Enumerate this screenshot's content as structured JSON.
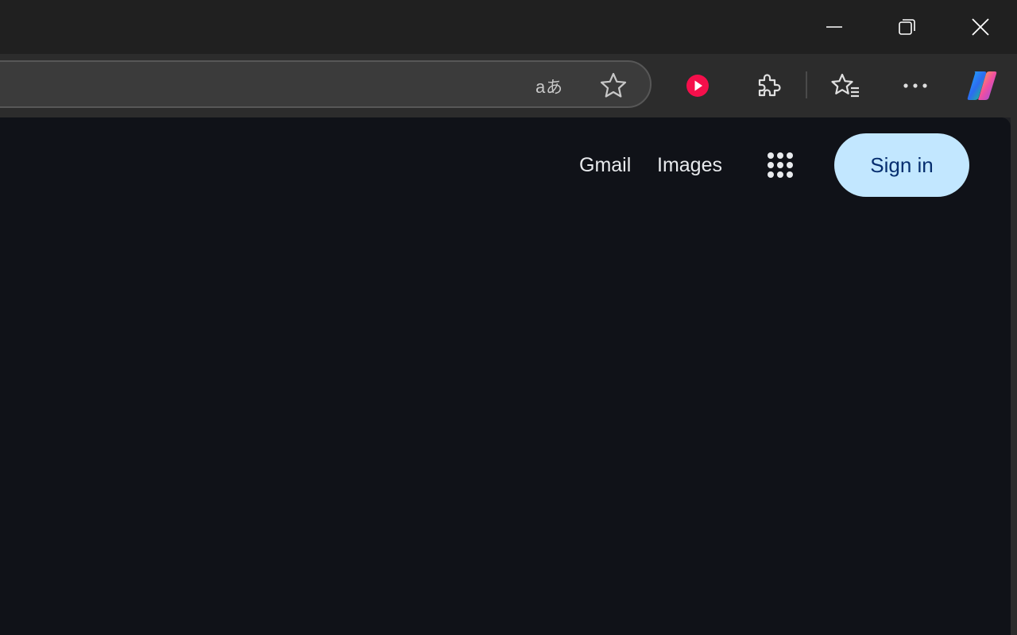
{
  "window_controls": {
    "minimize_icon": "minimize-icon",
    "restore_icon": "restore-icon",
    "close_icon": "close-icon"
  },
  "toolbar": {
    "translate_icon": "translate-icon",
    "favorite_icon": "star-icon",
    "media_icon": "play-icon",
    "extensions_icon": "puzzle-icon",
    "favorites_icon": "favorites-list-icon",
    "more_icon": "more-icon",
    "copilot_icon": "copilot-icon",
    "media_color": "#f50f4b"
  },
  "page": {
    "gmail_label": "Gmail",
    "images_label": "Images",
    "apps_icon": "apps-grid-icon",
    "signin_label": "Sign in",
    "signin_bg": "#c2e7ff",
    "background": "#101218"
  }
}
